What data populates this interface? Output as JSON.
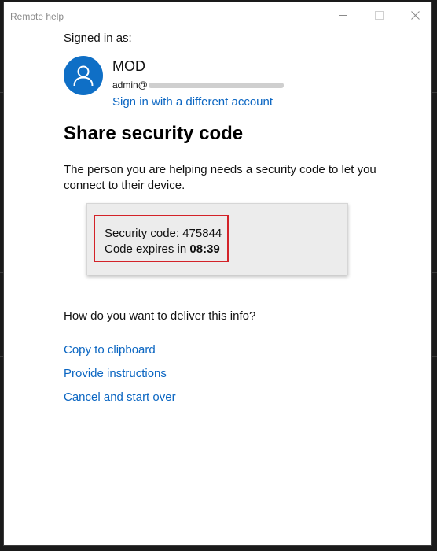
{
  "window": {
    "title": "Remote help"
  },
  "account": {
    "signed_in_label": "Signed in as:",
    "name": "MOD",
    "email_prefix": "admin@",
    "switch_account_link": "Sign in with a different account"
  },
  "main": {
    "heading": "Share security code",
    "description": "The person you are helping needs a security code to let you connect to their device."
  },
  "security_code": {
    "code_label": "Security code:",
    "code_value": "475844",
    "expires_label": "Code expires in",
    "expires_value": "08:39"
  },
  "delivery": {
    "question": "How do you want to deliver this info?",
    "options": [
      {
        "label": "Copy to clipboard"
      },
      {
        "label": "Provide instructions"
      },
      {
        "label": "Cancel and start over"
      }
    ]
  },
  "colors": {
    "accent_link": "#0b66c2",
    "avatar_bg": "#0f6fc6",
    "highlight_border": "#d32228"
  },
  "icons": {
    "avatar": "person-icon",
    "minimize": "minimize-icon",
    "maximize": "maximize-icon",
    "close": "close-icon"
  }
}
